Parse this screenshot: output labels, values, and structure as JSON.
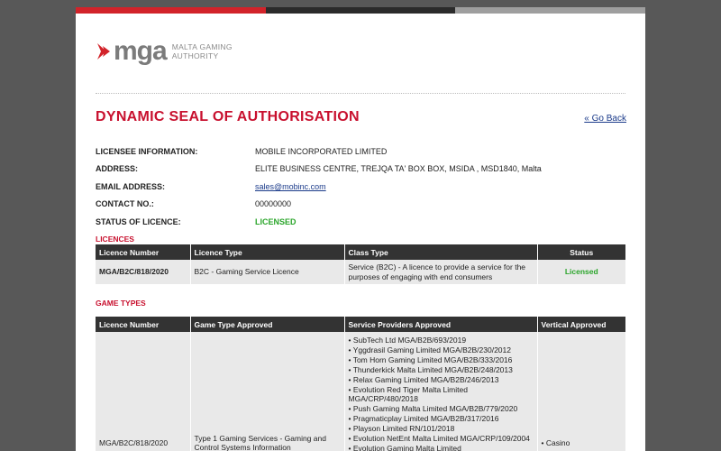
{
  "logo": {
    "word": "mga",
    "subtitle_line1": "MALTA GAMING",
    "subtitle_line2": "AUTHORITY",
    "accent": "#d2232a"
  },
  "page_title": "DYNAMIC SEAL OF AUTHORISATION",
  "go_back": "« Go Back",
  "info": [
    {
      "label": "LICENSEE INFORMATION:",
      "value": "MOBILE INCORPORATED LIMITED"
    },
    {
      "label": "ADDRESS:",
      "value": "ELITE BUSINESS CENTRE, TREJQA TA' BOX BOX, MSIDA , MSD1840, Malta"
    },
    {
      "label": "EMAIL ADDRESS:",
      "value": "sales@mobinc.com"
    },
    {
      "label": "CONTACT NO.:",
      "value": "00000000"
    },
    {
      "label": "STATUS OF LICENCE:",
      "value": "LICENSED"
    }
  ],
  "licences": {
    "heading": "LICENCES",
    "headers": [
      "Licence Number",
      "Licence Type",
      "Class Type",
      "Status"
    ],
    "row": {
      "number": "MGA/B2C/818/2020",
      "type": "B2C - Gaming Service Licence",
      "class": "Service (B2C) - A licence to provide a service for the purposes of engaging with end consumers",
      "status": "Licensed"
    }
  },
  "game_types": {
    "heading": "GAME TYPES",
    "headers": [
      "Licence Number",
      "Game Type Approved",
      "Service Providers Approved",
      "Vertical Approved"
    ],
    "row": {
      "number": "MGA/B2C/818/2020",
      "game_type": "Type 1 Gaming Services - Gaming and Control Systems Information",
      "providers": [
        "SubTech Ltd MGA/B2B/693/2019",
        "Yggdrasil Gaming Limited MGA/B2B/230/2012",
        "Tom Horn Gaming Limited MGA/B2B/333/2016",
        "Thunderkick Malta Limited MGA/B2B/248/2013",
        "Relax Gaming Limited MGA/B2B/246/2013",
        "Evolution Red Tiger Malta Limited MGA/CRP/480/2018",
        "Push Gaming Malta Limited MGA/B2B/779/2020",
        "Pragmaticplay Limited MGA/B2B/317/2016",
        "Playson Limited RN/101/2018",
        "Evolution NetEnt Malta Limited MGA/CRP/109/2004",
        "Evolution Gaming Malta Limited"
      ],
      "vertical": "• Casino"
    }
  }
}
